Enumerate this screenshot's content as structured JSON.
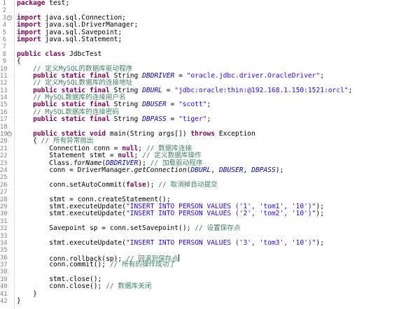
{
  "editor": {
    "lines": [
      {
        "n": "1",
        "fold": false,
        "tokens": [
          {
            "t": "kw",
            "v": "package"
          },
          {
            "t": "pl",
            "v": " test;"
          }
        ]
      },
      {
        "n": "2",
        "fold": false,
        "tokens": []
      },
      {
        "n": "3",
        "fold": true,
        "tokens": [
          {
            "t": "kw",
            "v": "import"
          },
          {
            "t": "pl",
            "v": " java.sql.Connection;"
          }
        ]
      },
      {
        "n": "4",
        "fold": false,
        "tokens": [
          {
            "t": "kw",
            "v": "import"
          },
          {
            "t": "pl",
            "v": " java.sql.DriverManager;"
          }
        ]
      },
      {
        "n": "5",
        "fold": false,
        "tokens": [
          {
            "t": "kw",
            "v": "import"
          },
          {
            "t": "pl",
            "v": " java.sql.Savepoint;"
          }
        ]
      },
      {
        "n": "6",
        "fold": false,
        "tokens": [
          {
            "t": "kw",
            "v": "import"
          },
          {
            "t": "pl",
            "v": " java.sql.Statement;"
          }
        ]
      },
      {
        "n": "7",
        "fold": false,
        "tokens": []
      },
      {
        "n": "8",
        "fold": false,
        "tokens": [
          {
            "t": "kw",
            "v": "public class"
          },
          {
            "t": "pl",
            "v": " JdbcTest"
          }
        ]
      },
      {
        "n": "9",
        "fold": false,
        "tokens": [
          {
            "t": "pl",
            "v": "{"
          }
        ]
      },
      {
        "n": "10",
        "fold": false,
        "tokens": [
          {
            "t": "pl",
            "v": "    "
          },
          {
            "t": "cm",
            "v": "// 定义MySQL的数据库驱动程序"
          }
        ]
      },
      {
        "n": "11",
        "fold": false,
        "tokens": [
          {
            "t": "pl",
            "v": "    "
          },
          {
            "t": "kw",
            "v": "public static final"
          },
          {
            "t": "pl",
            "v": " String "
          },
          {
            "t": "fi",
            "v": "DBDRIVER"
          },
          {
            "t": "pl",
            "v": " = "
          },
          {
            "t": "st",
            "v": "\"oracle.jdbc.driver.OracleDriver\""
          },
          {
            "t": "pl",
            "v": ";"
          }
        ]
      },
      {
        "n": "12",
        "fold": false,
        "tokens": [
          {
            "t": "pl",
            "v": "    "
          },
          {
            "t": "cm",
            "v": "// 定义MySQL数据库的连接地址"
          }
        ]
      },
      {
        "n": "13",
        "fold": false,
        "tokens": [
          {
            "t": "pl",
            "v": "    "
          },
          {
            "t": "kw",
            "v": "public static final"
          },
          {
            "t": "pl",
            "v": " String "
          },
          {
            "t": "fi",
            "v": "DBURL"
          },
          {
            "t": "pl",
            "v": " = "
          },
          {
            "t": "st",
            "v": "\"jdbc:oracle:thin:@192.168.1.150:1521:orcl\""
          },
          {
            "t": "pl",
            "v": ";"
          }
        ]
      },
      {
        "n": "14",
        "fold": false,
        "tokens": [
          {
            "t": "pl",
            "v": "    "
          },
          {
            "t": "cm",
            "v": "// MySQL数据库的连接用户名"
          }
        ]
      },
      {
        "n": "15",
        "fold": false,
        "tokens": [
          {
            "t": "pl",
            "v": "    "
          },
          {
            "t": "kw",
            "v": "public static final"
          },
          {
            "t": "pl",
            "v": " String "
          },
          {
            "t": "fi",
            "v": "DBUSER"
          },
          {
            "t": "pl",
            "v": " = "
          },
          {
            "t": "st",
            "v": "\"scott\""
          },
          {
            "t": "pl",
            "v": ";"
          }
        ]
      },
      {
        "n": "16",
        "fold": false,
        "tokens": [
          {
            "t": "pl",
            "v": "    "
          },
          {
            "t": "cm",
            "v": "// MySQL数据库的连接密码"
          }
        ]
      },
      {
        "n": "17",
        "fold": false,
        "tokens": [
          {
            "t": "pl",
            "v": "    "
          },
          {
            "t": "kw",
            "v": "public static final"
          },
          {
            "t": "pl",
            "v": " String "
          },
          {
            "t": "fi",
            "v": "DBPASS"
          },
          {
            "t": "pl",
            "v": " = "
          },
          {
            "t": "st",
            "v": "\"tiger\""
          },
          {
            "t": "pl",
            "v": ";"
          }
        ]
      },
      {
        "n": "18",
        "fold": false,
        "tokens": []
      },
      {
        "n": "19",
        "fold": true,
        "tokens": [
          {
            "t": "pl",
            "v": "    "
          },
          {
            "t": "kw",
            "v": "public static void"
          },
          {
            "t": "pl",
            "v": " main(String args[]) "
          },
          {
            "t": "kw",
            "v": "throws"
          },
          {
            "t": "pl",
            "v": " Exception"
          }
        ]
      },
      {
        "n": "20",
        "fold": false,
        "tokens": [
          {
            "t": "pl",
            "v": "    { "
          },
          {
            "t": "cm",
            "v": "// 所有异常抛出"
          }
        ]
      },
      {
        "n": "21",
        "fold": false,
        "tokens": [
          {
            "t": "pl",
            "v": "        Connection conn = "
          },
          {
            "t": "kw",
            "v": "null"
          },
          {
            "t": "pl",
            "v": "; "
          },
          {
            "t": "cm",
            "v": "// 数据库连接"
          }
        ]
      },
      {
        "n": "22",
        "fold": false,
        "tokens": [
          {
            "t": "pl",
            "v": "        Statement stmt = "
          },
          {
            "t": "kw",
            "v": "null"
          },
          {
            "t": "pl",
            "v": "; "
          },
          {
            "t": "cm",
            "v": "// 定义数据库操作"
          }
        ]
      },
      {
        "n": "23",
        "fold": false,
        "tokens": [
          {
            "t": "pl",
            "v": "        Class."
          },
          {
            "t": "it",
            "v": "forName"
          },
          {
            "t": "pl",
            "v": "("
          },
          {
            "t": "fi",
            "v": "DBDRIVER"
          },
          {
            "t": "pl",
            "v": "); "
          },
          {
            "t": "cm",
            "v": "// 加载驱动程序"
          }
        ]
      },
      {
        "n": "24",
        "fold": false,
        "tokens": [
          {
            "t": "pl",
            "v": "        conn = DriverManager."
          },
          {
            "t": "it",
            "v": "getConnection"
          },
          {
            "t": "pl",
            "v": "("
          },
          {
            "t": "fi",
            "v": "DBURL"
          },
          {
            "t": "pl",
            "v": ", "
          },
          {
            "t": "fi",
            "v": "DBUSER"
          },
          {
            "t": "pl",
            "v": ", "
          },
          {
            "t": "fi",
            "v": "DBPASS"
          },
          {
            "t": "pl",
            "v": ");"
          }
        ]
      },
      {
        "n": "25",
        "fold": false,
        "tokens": []
      },
      {
        "n": "26",
        "fold": false,
        "tokens": [
          {
            "t": "pl",
            "v": "        conn.setAutoCommit("
          },
          {
            "t": "kw",
            "v": "false"
          },
          {
            "t": "pl",
            "v": "); "
          },
          {
            "t": "cm",
            "v": "// 取消掉自动提交"
          }
        ]
      },
      {
        "n": "27",
        "fold": false,
        "tokens": []
      },
      {
        "n": "28",
        "fold": false,
        "tokens": [
          {
            "t": "pl",
            "v": "        stmt = conn.createStatement();"
          }
        ]
      },
      {
        "n": "29",
        "fold": false,
        "tokens": [
          {
            "t": "pl",
            "v": "        stmt.executeUpdate("
          },
          {
            "t": "st",
            "v": "\"INSERT INTO PERSON VALUES ('1', 'tom1', '10')\""
          },
          {
            "t": "pl",
            "v": ");"
          }
        ]
      },
      {
        "n": "30",
        "fold": false,
        "tokens": [
          {
            "t": "pl",
            "v": "        stmt.executeUpdate("
          },
          {
            "t": "st",
            "v": "\"INSERT INTO PERSON VALUES ('2', 'tom2', '10')\""
          },
          {
            "t": "pl",
            "v": ");"
          }
        ]
      },
      {
        "n": "31",
        "fold": false,
        "tokens": []
      },
      {
        "n": "32",
        "fold": false,
        "tokens": [
          {
            "t": "pl",
            "v": "        Savepoint sp = conn.setSavepoint(); "
          },
          {
            "t": "cm",
            "v": "// 设置保存点"
          }
        ]
      },
      {
        "n": "33",
        "fold": false,
        "tokens": []
      },
      {
        "n": "34",
        "fold": false,
        "tokens": [
          {
            "t": "pl",
            "v": "        stmt.executeUpdate("
          },
          {
            "t": "st",
            "v": "\"INSERT INTO PERSON VALUES ('3', 'tom3', '10')\""
          },
          {
            "t": "pl",
            "v": ");"
          }
        ]
      },
      {
        "n": "35",
        "fold": false,
        "tokens": []
      },
      {
        "n": "36",
        "fold": false,
        "tokens": [
          {
            "t": "pl",
            "v": "        conn.rollback(sp); "
          },
          {
            "t": "cm",
            "v": "// 回滚到保存点"
          },
          {
            "t": "caret",
            "v": ""
          }
        ]
      },
      {
        "n": "37",
        "fold": false,
        "tokens": [
          {
            "t": "pl",
            "v": "        conn.commit(); "
          },
          {
            "t": "cm",
            "v": "// 所有的操作成功了"
          }
        ]
      },
      {
        "n": "38",
        "fold": false,
        "tokens": []
      },
      {
        "n": "39",
        "fold": false,
        "tokens": [
          {
            "t": "pl",
            "v": "        stmt.close();"
          }
        ]
      },
      {
        "n": "40",
        "fold": false,
        "tokens": [
          {
            "t": "pl",
            "v": "        conn.close(); "
          },
          {
            "t": "cm",
            "v": "// 数据库关闭"
          }
        ]
      },
      {
        "n": "41",
        "fold": false,
        "tokens": [
          {
            "t": "pl",
            "v": "    }"
          }
        ]
      },
      {
        "n": "42",
        "fold": false,
        "tokens": [
          {
            "t": "pl",
            "v": "}"
          }
        ]
      }
    ]
  },
  "colors": {
    "keyword": "#7f0055",
    "comment": "#3f7f5f",
    "string": "#2a00ff",
    "field": "#0000c0",
    "line_number": "#808080"
  },
  "icons": {
    "fold": "fold-collapse-icon"
  }
}
